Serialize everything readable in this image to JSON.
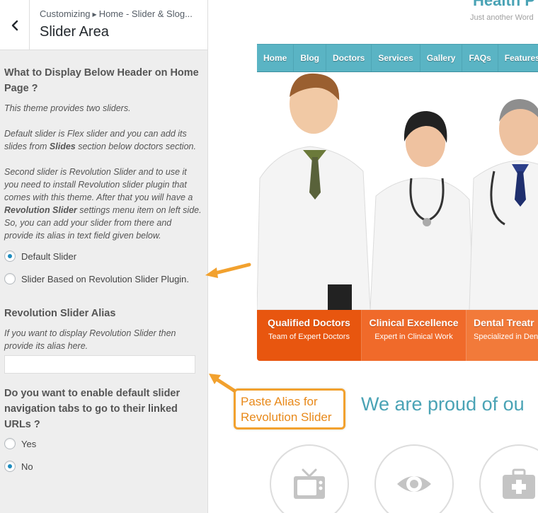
{
  "customizer": {
    "breadcrumb_prefix": "Customizing",
    "breadcrumb_section": "Home - Slider & Slog...",
    "section_title": "Slider Area"
  },
  "display_setting": {
    "question": "What to Display Below Header on Home Page ?",
    "description_1": "This theme provides two sliders.",
    "description_2_before": "Default slider is Flex slider and you can add its slides from ",
    "description_2_bold": "Slides",
    "description_2_after": " section below doctors section.",
    "description_3_before": "Second slider is Revolution Slider and to use it you need to install Revolution slider plugin that comes with this theme. After that you will have a ",
    "description_3_bold": "Revolution Slider",
    "description_3_after": " settings menu item on left side. So, you can add your slider from there and provide its alias in text field given below.",
    "options": [
      {
        "label": "Default Slider",
        "selected": true
      },
      {
        "label": "Slider Based on Revolution Slider Plugin.",
        "selected": false
      }
    ]
  },
  "alias_setting": {
    "label": "Revolution Slider Alias",
    "description": "If you want to display Revolution Slider then provide its alias here.",
    "value": ""
  },
  "nav_tabs_setting": {
    "question": "Do you want to enable default slider navigation tabs to go to their linked URLs ?",
    "options": [
      {
        "label": "Yes",
        "selected": false
      },
      {
        "label": "No",
        "selected": true
      }
    ]
  },
  "preview": {
    "site_title": "Health P",
    "site_tagline": "Just another Word",
    "nav": [
      "Home",
      "Blog",
      "Doctors",
      "Services",
      "Gallery",
      "FAQs",
      "Features"
    ],
    "slider_tabs": [
      {
        "title": "Qualified Doctors",
        "subtitle": "Team of Expert Doctors",
        "color": "#e8560f"
      },
      {
        "title": "Clinical Excellence",
        "subtitle": "Expert in Clinical Work",
        "color": "#f06a2a"
      },
      {
        "title": "Dental Treatr",
        "subtitle": "Specialized in Dent",
        "color": "#f27a3a"
      }
    ],
    "proud_heading": "We are proud of ou",
    "service_icons": [
      "tv-icon",
      "eye-icon",
      "medical-kit-icon"
    ]
  },
  "annotation": {
    "line1": "Paste Alias for",
    "line2": "Revolution Slider",
    "color": "#f2a12e"
  }
}
